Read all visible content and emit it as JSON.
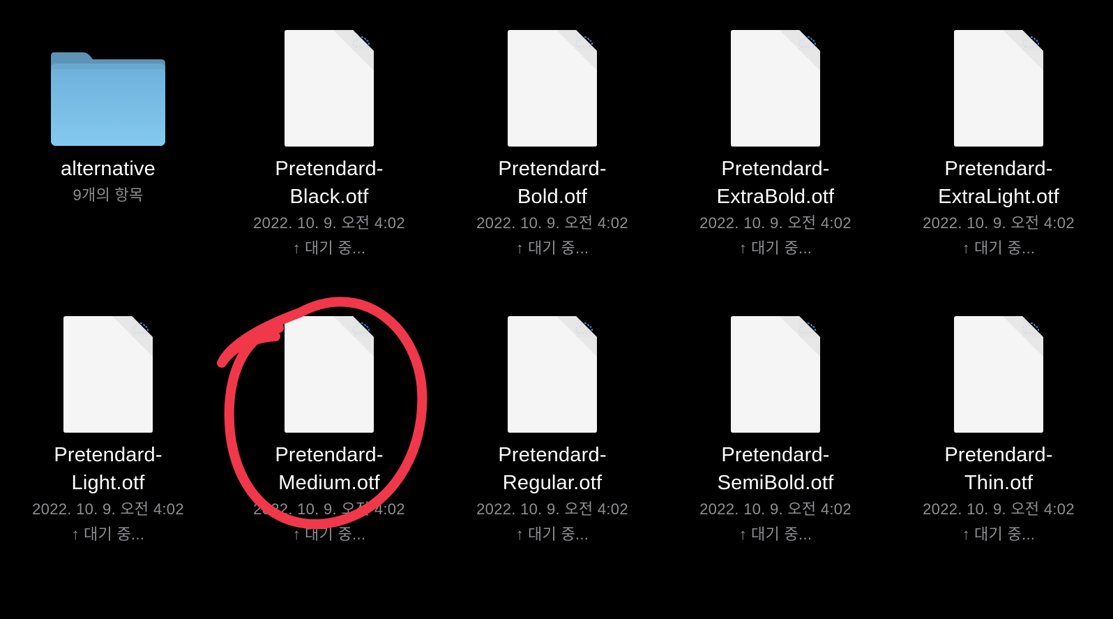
{
  "folder": {
    "name": "alternative",
    "item_count": "9개의 항목",
    "icon": "folder-icon",
    "color": "#76bde6"
  },
  "files": [
    {
      "name_line1": "Pretendard-",
      "name_line2": "Black.otf",
      "date": "2022. 10. 9. 오전 4:02",
      "status": "대기 중...",
      "status_icon": "upload-arrow-icon",
      "cloud_icon": "icloud-pending-icon"
    },
    {
      "name_line1": "Pretendard-",
      "name_line2": "Bold.otf",
      "date": "2022. 10. 9. 오전 4:02",
      "status": "대기 중...",
      "status_icon": "upload-arrow-icon",
      "cloud_icon": "icloud-pending-icon"
    },
    {
      "name_line1": "Pretendard-",
      "name_line2": "ExtraBold.otf",
      "date": "2022. 10. 9. 오전 4:02",
      "status": "대기 중...",
      "status_icon": "upload-arrow-icon",
      "cloud_icon": "icloud-pending-icon"
    },
    {
      "name_line1": "Pretendard-",
      "name_line2": "ExtraLight.otf",
      "date": "2022. 10. 9. 오전 4:02",
      "status": "대기 중...",
      "status_icon": "upload-arrow-icon",
      "cloud_icon": "icloud-pending-icon"
    },
    {
      "name_line1": "Pretendard-",
      "name_line2": "Light.otf",
      "date": "2022. 10. 9. 오전 4:02",
      "status": "대기 중...",
      "status_icon": "upload-arrow-icon",
      "cloud_icon": "icloud-pending-icon"
    },
    {
      "name_line1": "Pretendard-",
      "name_line2": "Medium.otf",
      "date": "2022. 10. 9. 오전 4:02",
      "status": "대기 중...",
      "status_icon": "upload-arrow-icon",
      "cloud_icon": "icloud-pending-icon"
    },
    {
      "name_line1": "Pretendard-",
      "name_line2": "Regular.otf",
      "date": "2022. 10. 9. 오전 4:02",
      "status": "대기 중...",
      "status_icon": "upload-arrow-icon",
      "cloud_icon": "icloud-pending-icon"
    },
    {
      "name_line1": "Pretendard-",
      "name_line2": "SemiBold.otf",
      "date": "2022. 10. 9. 오전 4:02",
      "status": "대기 중...",
      "status_icon": "upload-arrow-icon",
      "cloud_icon": "icloud-pending-icon"
    },
    {
      "name_line1": "Pretendard-",
      "name_line2": "Thin.otf",
      "date": "2022. 10. 9. 오전 4:02",
      "status": "대기 중...",
      "status_icon": "upload-arrow-icon",
      "cloud_icon": "icloud-pending-icon"
    }
  ],
  "status_arrow": "↑",
  "annotation": {
    "type": "hand-drawn-circle",
    "target": "Pretendard-Medium.otf",
    "color": "#f0384a"
  },
  "colors": {
    "background": "#000000",
    "primary_text": "#ffffff",
    "secondary_text": "#8e8e93",
    "document_page": "#f5f5f5",
    "cloud_icon": "#4a90e2"
  }
}
